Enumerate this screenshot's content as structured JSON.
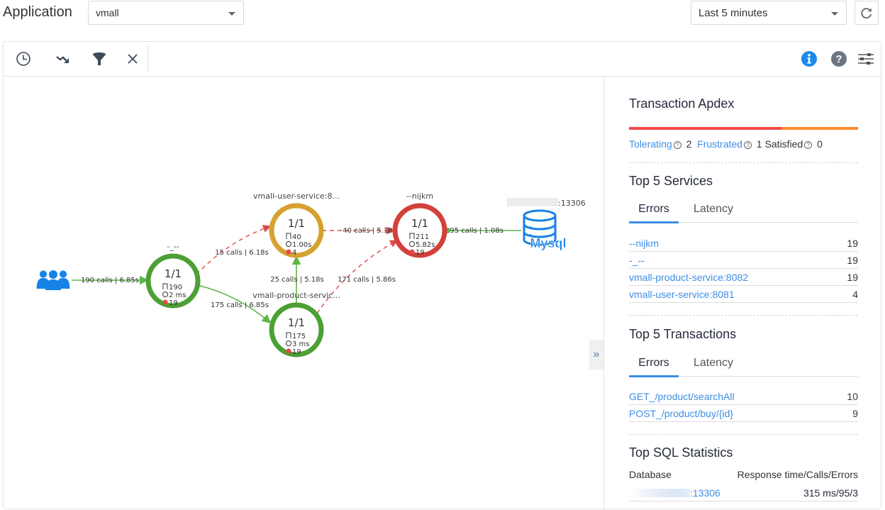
{
  "header": {
    "app_label": "Application",
    "app_select_value": "vmall",
    "time_select_value": "Last 5 minutes",
    "refresh_icon": "refresh-icon"
  },
  "toolbar": {
    "left_icons": [
      "clock-icon",
      "trend-down-icon",
      "filter-icon",
      "close-icon"
    ],
    "right_icons": [
      "info-icon",
      "help-icon",
      "settings-sliders-icon"
    ]
  },
  "graph": {
    "colors": {
      "healthy": "#4ca034",
      "warning": "#d6a12f",
      "critical": "#d3403a",
      "link_ok": "#5bb646",
      "link_err": "#e04a4a",
      "user": "#1682e6"
    },
    "users_icon": "users-icon",
    "nodes": [
      {
        "id": "gateway",
        "name": "-_--",
        "ratio": "1/1",
        "calls": "190",
        "latency": "2 ms",
        "errors": "19",
        "status": "healthy"
      },
      {
        "id": "user",
        "name": "vmall-user-service:8...",
        "ratio": "1/1",
        "calls": "40",
        "latency": "1.00s",
        "errors": "4",
        "status": "warning"
      },
      {
        "id": "product",
        "name": "vmall-product-servic...",
        "ratio": "1/1",
        "calls": "175",
        "latency": "3 ms",
        "errors": "19",
        "status": "healthy"
      },
      {
        "id": "nijkm",
        "name": "--nijkm",
        "ratio": "1/1",
        "calls": "211",
        "latency": "5.82s",
        "errors": "19",
        "status": "critical"
      }
    ],
    "database": {
      "label": "Mysql",
      "address_suffix": ":13306",
      "icon": "database-icon"
    },
    "edges": [
      {
        "from": "users",
        "to": "gateway",
        "label": "190 calls | 6.85s",
        "type": "ok"
      },
      {
        "from": "gateway",
        "to": "user",
        "label": "15 calls | 6.18s",
        "type": "err"
      },
      {
        "from": "gateway",
        "to": "product",
        "label": "175 calls | 6.85s",
        "type": "ok"
      },
      {
        "from": "product",
        "to": "user",
        "label": "25 calls | 5.18s",
        "type": "ok"
      },
      {
        "from": "user",
        "to": "nijkm",
        "label": "40 calls | 5.18s",
        "type": "err"
      },
      {
        "from": "product",
        "to": "nijkm",
        "label": "171 calls | 5.86s",
        "type": "err"
      },
      {
        "from": "nijkm",
        "to": "db",
        "label": "195 calls | 1.08s",
        "type": "ok"
      }
    ],
    "collapse_label": "»"
  },
  "apdex": {
    "title": "Transaction Apdex",
    "bar": {
      "frustrated_fraction": 0.667,
      "tolerating_fraction": 0.333
    },
    "tolerating_label": "Tolerating",
    "tolerating_value": "2",
    "frustrated_label": "Frustrated",
    "frustrated_value": "1",
    "satisfied_label": "Satisfied",
    "satisfied_value": "0",
    "help_glyph": "?"
  },
  "top_services": {
    "title": "Top 5 Services",
    "tabs": [
      "Errors",
      "Latency"
    ],
    "active_tab": "Errors",
    "rows": [
      {
        "name": "--nijkm",
        "value": "19"
      },
      {
        "name": "-_--",
        "value": "19"
      },
      {
        "name": "vmall-product-service:8082",
        "value": "19"
      },
      {
        "name": "vmall-user-service:8081",
        "value": "4"
      }
    ]
  },
  "top_transactions": {
    "title": "Top 5 Transactions",
    "tabs": [
      "Errors",
      "Latency"
    ],
    "active_tab": "Errors",
    "rows": [
      {
        "name": "GET_/product/searchAll",
        "value": "10"
      },
      {
        "name": "POST_/product/buy/{id}",
        "value": "9"
      }
    ]
  },
  "top_sql": {
    "title": "Top SQL Statistics",
    "col_database": "Database",
    "col_metrics": "Response time/Calls/Errors",
    "rows": [
      {
        "database_suffix": ":13306",
        "value": "315 ms/95/3"
      }
    ]
  }
}
